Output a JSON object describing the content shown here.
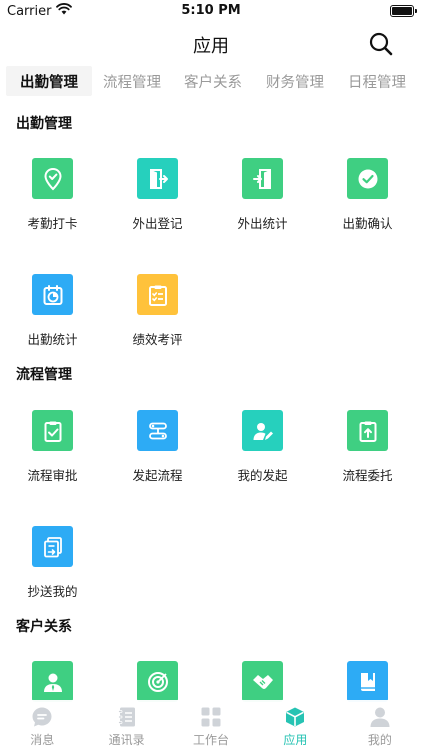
{
  "status_bar": {
    "carrier": "Carrier",
    "time": "5:10 PM"
  },
  "nav": {
    "title": "应用"
  },
  "tabs": [
    {
      "label": "出勤管理",
      "active": true
    },
    {
      "label": "流程管理",
      "active": false
    },
    {
      "label": "客户关系",
      "active": false
    },
    {
      "label": "财务管理",
      "active": false
    },
    {
      "label": "日程管理",
      "active": false
    }
  ],
  "sections": {
    "attendance": {
      "title": "出勤管理",
      "items": [
        {
          "label": "考勤打卡",
          "icon": "location-check-icon",
          "color": "#3fcf82"
        },
        {
          "label": "外出登记",
          "icon": "door-exit-icon",
          "color": "#26d0bd"
        },
        {
          "label": "外出统计",
          "icon": "door-enter-icon",
          "color": "#3fcf82"
        },
        {
          "label": "出勤确认",
          "icon": "check-circle-icon",
          "color": "#3fcf82"
        },
        {
          "label": "出勤统计",
          "icon": "calendar-chart-icon",
          "color": "#2dabf5"
        },
        {
          "label": "绩效考评",
          "icon": "checklist-icon",
          "color": "#ffc23b"
        }
      ]
    },
    "workflow": {
      "title": "流程管理",
      "items": [
        {
          "label": "流程审批",
          "icon": "clipboard-check-icon",
          "color": "#3fcf82"
        },
        {
          "label": "发起流程",
          "icon": "flow-icon",
          "color": "#2dabf5"
        },
        {
          "label": "我的发起",
          "icon": "user-edit-icon",
          "color": "#26d0bd"
        },
        {
          "label": "流程委托",
          "icon": "clipboard-upload-icon",
          "color": "#3fcf82"
        },
        {
          "label": "抄送我的",
          "icon": "copy-forward-icon",
          "color": "#2dabf5"
        }
      ]
    },
    "customer": {
      "title": "客户关系",
      "items": [
        {
          "label": "",
          "icon": "contact-icon",
          "color": "#3fcf82"
        },
        {
          "label": "",
          "icon": "target-icon",
          "color": "#3fcf82"
        },
        {
          "label": "",
          "icon": "handshake-icon",
          "color": "#3fcf82"
        },
        {
          "label": "",
          "icon": "book-icon",
          "color": "#2dabf5"
        }
      ]
    }
  },
  "bottom_tabs": [
    {
      "label": "消息",
      "icon": "message-icon",
      "active": false
    },
    {
      "label": "通讯录",
      "icon": "contacts-book-icon",
      "active": false
    },
    {
      "label": "工作台",
      "icon": "workbench-grid-icon",
      "active": false
    },
    {
      "label": "应用",
      "icon": "cube-icon",
      "active": true
    },
    {
      "label": "我的",
      "icon": "profile-icon",
      "active": false
    }
  ],
  "colors": {
    "accent": "#26c3b3",
    "green": "#3fcf82",
    "teal": "#26d0bd",
    "blue": "#2dabf5",
    "orange": "#ffc23b"
  }
}
